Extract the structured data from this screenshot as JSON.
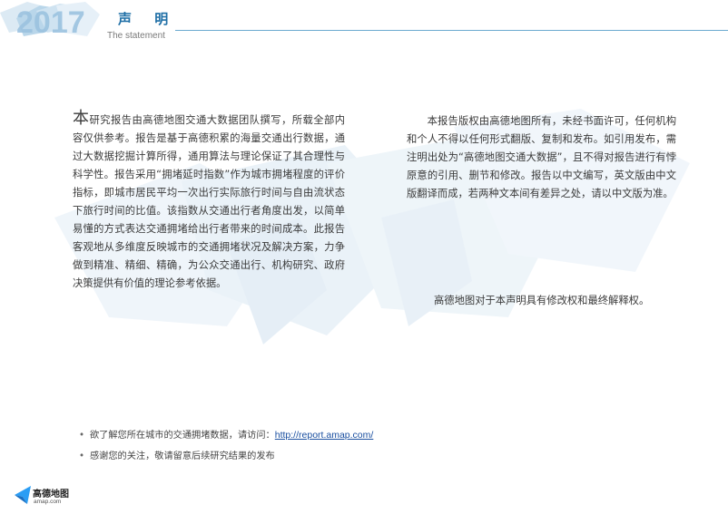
{
  "header": {
    "title": "声 明",
    "subtitle": "The statement",
    "logo_text": "2017"
  },
  "left_paragraph": {
    "first_char": "本",
    "text": "研究报告由高德地图交通大数据团队撰写，所载全部内容仅供参考。报告是基于高德积累的海量交通出行数据，通过大数据挖掘计算所得，通用算法与理论保证了其合理性与科学性。报告采用“拥堵延时指数”作为城市拥堵程度的评价指标，即城市居民平均一次出行实际旅行时间与自由流状态下旅行时间的比值。该指数从交通出行者角度出发，以简单易懂的方式表达交通拥堵给出行者带来的时间成本。此报告客观地从多维度反映城市的交通拥堵状况及解决方案，力争做到精准、精细、精确，为公众交通出行、机构研究、政府决策提供有价值的理论参考依据。"
  },
  "right_paragraph": "本报告版权由高德地图所有，未经书面许可，任何机构和个人不得以任何形式翻版、复制和发布。如引用发布，需注明出处为“高德地图交通大数据”，且不得对报告进行有悖原意的引用、删节和修改。报告以中文编写，英文版由中文版翻译而成，若两种文本间有差异之处，请以中文版为准。",
  "note": "高德地图对于本声明具有修改权和最终解释权。",
  "bullets": {
    "dot": "•",
    "item1_text": "欲了解您所在城市的交通拥堵数据，请访问：",
    "item1_link": "http://report.amap.com/",
    "item2_text": "感谢您的关注，敬请留意后续研究结果的发布"
  },
  "footer": {
    "logo_name": "高德地图",
    "logo_url": "amap.com"
  },
  "colors": {
    "accent": "#1f6fa6",
    "rule": "#6aa9cf",
    "link": "#1a4fa0",
    "watermark": "#e4eef6"
  }
}
